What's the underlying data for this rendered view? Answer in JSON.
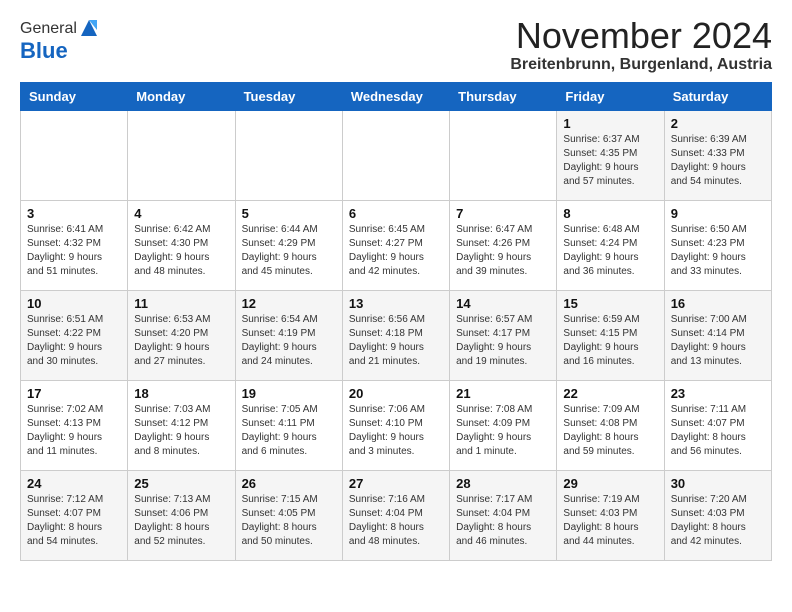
{
  "header": {
    "logo_general": "General",
    "logo_blue": "Blue",
    "month_title": "November 2024",
    "location": "Breitenbrunn, Burgenland, Austria"
  },
  "weekdays": [
    "Sunday",
    "Monday",
    "Tuesday",
    "Wednesday",
    "Thursday",
    "Friday",
    "Saturday"
  ],
  "weeks": [
    [
      {
        "day": "",
        "info": ""
      },
      {
        "day": "",
        "info": ""
      },
      {
        "day": "",
        "info": ""
      },
      {
        "day": "",
        "info": ""
      },
      {
        "day": "",
        "info": ""
      },
      {
        "day": "1",
        "info": "Sunrise: 6:37 AM\nSunset: 4:35 PM\nDaylight: 9 hours\nand 57 minutes."
      },
      {
        "day": "2",
        "info": "Sunrise: 6:39 AM\nSunset: 4:33 PM\nDaylight: 9 hours\nand 54 minutes."
      }
    ],
    [
      {
        "day": "3",
        "info": "Sunrise: 6:41 AM\nSunset: 4:32 PM\nDaylight: 9 hours\nand 51 minutes."
      },
      {
        "day": "4",
        "info": "Sunrise: 6:42 AM\nSunset: 4:30 PM\nDaylight: 9 hours\nand 48 minutes."
      },
      {
        "day": "5",
        "info": "Sunrise: 6:44 AM\nSunset: 4:29 PM\nDaylight: 9 hours\nand 45 minutes."
      },
      {
        "day": "6",
        "info": "Sunrise: 6:45 AM\nSunset: 4:27 PM\nDaylight: 9 hours\nand 42 minutes."
      },
      {
        "day": "7",
        "info": "Sunrise: 6:47 AM\nSunset: 4:26 PM\nDaylight: 9 hours\nand 39 minutes."
      },
      {
        "day": "8",
        "info": "Sunrise: 6:48 AM\nSunset: 4:24 PM\nDaylight: 9 hours\nand 36 minutes."
      },
      {
        "day": "9",
        "info": "Sunrise: 6:50 AM\nSunset: 4:23 PM\nDaylight: 9 hours\nand 33 minutes."
      }
    ],
    [
      {
        "day": "10",
        "info": "Sunrise: 6:51 AM\nSunset: 4:22 PM\nDaylight: 9 hours\nand 30 minutes."
      },
      {
        "day": "11",
        "info": "Sunrise: 6:53 AM\nSunset: 4:20 PM\nDaylight: 9 hours\nand 27 minutes."
      },
      {
        "day": "12",
        "info": "Sunrise: 6:54 AM\nSunset: 4:19 PM\nDaylight: 9 hours\nand 24 minutes."
      },
      {
        "day": "13",
        "info": "Sunrise: 6:56 AM\nSunset: 4:18 PM\nDaylight: 9 hours\nand 21 minutes."
      },
      {
        "day": "14",
        "info": "Sunrise: 6:57 AM\nSunset: 4:17 PM\nDaylight: 9 hours\nand 19 minutes."
      },
      {
        "day": "15",
        "info": "Sunrise: 6:59 AM\nSunset: 4:15 PM\nDaylight: 9 hours\nand 16 minutes."
      },
      {
        "day": "16",
        "info": "Sunrise: 7:00 AM\nSunset: 4:14 PM\nDaylight: 9 hours\nand 13 minutes."
      }
    ],
    [
      {
        "day": "17",
        "info": "Sunrise: 7:02 AM\nSunset: 4:13 PM\nDaylight: 9 hours\nand 11 minutes."
      },
      {
        "day": "18",
        "info": "Sunrise: 7:03 AM\nSunset: 4:12 PM\nDaylight: 9 hours\nand 8 minutes."
      },
      {
        "day": "19",
        "info": "Sunrise: 7:05 AM\nSunset: 4:11 PM\nDaylight: 9 hours\nand 6 minutes."
      },
      {
        "day": "20",
        "info": "Sunrise: 7:06 AM\nSunset: 4:10 PM\nDaylight: 9 hours\nand 3 minutes."
      },
      {
        "day": "21",
        "info": "Sunrise: 7:08 AM\nSunset: 4:09 PM\nDaylight: 9 hours\nand 1 minute."
      },
      {
        "day": "22",
        "info": "Sunrise: 7:09 AM\nSunset: 4:08 PM\nDaylight: 8 hours\nand 59 minutes."
      },
      {
        "day": "23",
        "info": "Sunrise: 7:11 AM\nSunset: 4:07 PM\nDaylight: 8 hours\nand 56 minutes."
      }
    ],
    [
      {
        "day": "24",
        "info": "Sunrise: 7:12 AM\nSunset: 4:07 PM\nDaylight: 8 hours\nand 54 minutes."
      },
      {
        "day": "25",
        "info": "Sunrise: 7:13 AM\nSunset: 4:06 PM\nDaylight: 8 hours\nand 52 minutes."
      },
      {
        "day": "26",
        "info": "Sunrise: 7:15 AM\nSunset: 4:05 PM\nDaylight: 8 hours\nand 50 minutes."
      },
      {
        "day": "27",
        "info": "Sunrise: 7:16 AM\nSunset: 4:04 PM\nDaylight: 8 hours\nand 48 minutes."
      },
      {
        "day": "28",
        "info": "Sunrise: 7:17 AM\nSunset: 4:04 PM\nDaylight: 8 hours\nand 46 minutes."
      },
      {
        "day": "29",
        "info": "Sunrise: 7:19 AM\nSunset: 4:03 PM\nDaylight: 8 hours\nand 44 minutes."
      },
      {
        "day": "30",
        "info": "Sunrise: 7:20 AM\nSunset: 4:03 PM\nDaylight: 8 hours\nand 42 minutes."
      }
    ]
  ]
}
